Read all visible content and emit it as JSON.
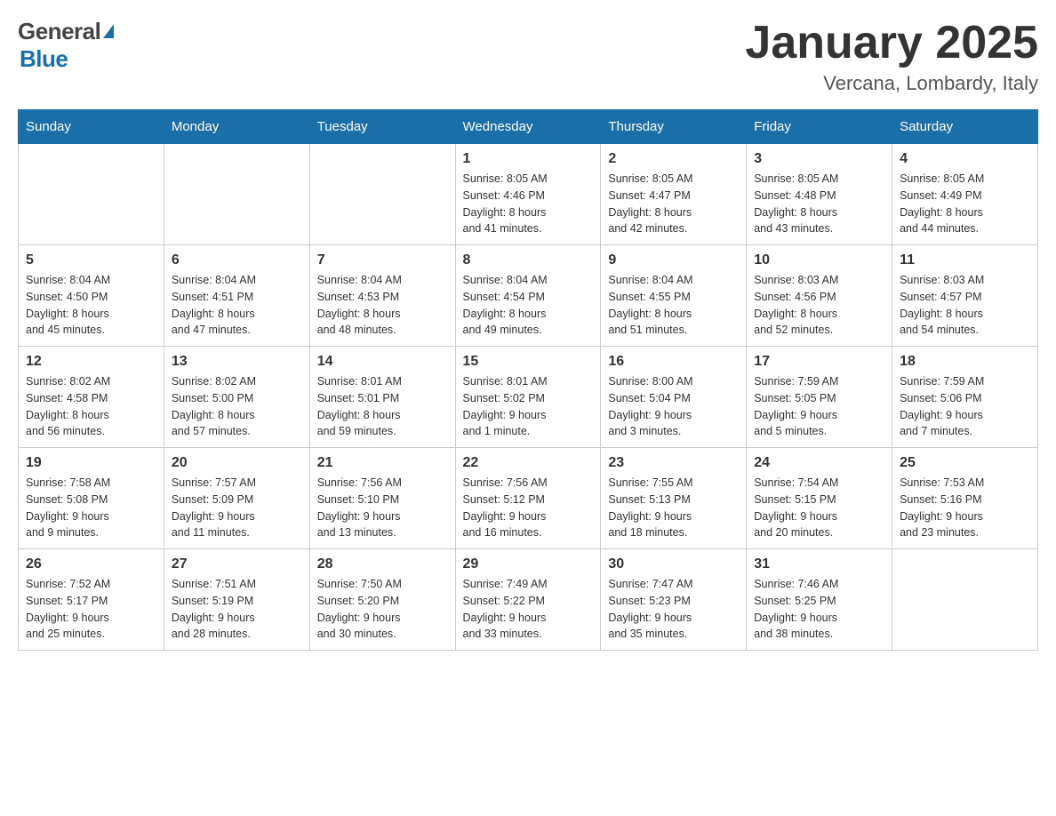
{
  "header": {
    "title": "January 2025",
    "subtitle": "Vercana, Lombardy, Italy"
  },
  "logo": {
    "part1": "General",
    "part2": "Blue"
  },
  "columns": [
    "Sunday",
    "Monday",
    "Tuesday",
    "Wednesday",
    "Thursday",
    "Friday",
    "Saturday"
  ],
  "weeks": [
    [
      {
        "day": "",
        "info": ""
      },
      {
        "day": "",
        "info": ""
      },
      {
        "day": "",
        "info": ""
      },
      {
        "day": "1",
        "info": "Sunrise: 8:05 AM\nSunset: 4:46 PM\nDaylight: 8 hours\nand 41 minutes."
      },
      {
        "day": "2",
        "info": "Sunrise: 8:05 AM\nSunset: 4:47 PM\nDaylight: 8 hours\nand 42 minutes."
      },
      {
        "day": "3",
        "info": "Sunrise: 8:05 AM\nSunset: 4:48 PM\nDaylight: 8 hours\nand 43 minutes."
      },
      {
        "day": "4",
        "info": "Sunrise: 8:05 AM\nSunset: 4:49 PM\nDaylight: 8 hours\nand 44 minutes."
      }
    ],
    [
      {
        "day": "5",
        "info": "Sunrise: 8:04 AM\nSunset: 4:50 PM\nDaylight: 8 hours\nand 45 minutes."
      },
      {
        "day": "6",
        "info": "Sunrise: 8:04 AM\nSunset: 4:51 PM\nDaylight: 8 hours\nand 47 minutes."
      },
      {
        "day": "7",
        "info": "Sunrise: 8:04 AM\nSunset: 4:53 PM\nDaylight: 8 hours\nand 48 minutes."
      },
      {
        "day": "8",
        "info": "Sunrise: 8:04 AM\nSunset: 4:54 PM\nDaylight: 8 hours\nand 49 minutes."
      },
      {
        "day": "9",
        "info": "Sunrise: 8:04 AM\nSunset: 4:55 PM\nDaylight: 8 hours\nand 51 minutes."
      },
      {
        "day": "10",
        "info": "Sunrise: 8:03 AM\nSunset: 4:56 PM\nDaylight: 8 hours\nand 52 minutes."
      },
      {
        "day": "11",
        "info": "Sunrise: 8:03 AM\nSunset: 4:57 PM\nDaylight: 8 hours\nand 54 minutes."
      }
    ],
    [
      {
        "day": "12",
        "info": "Sunrise: 8:02 AM\nSunset: 4:58 PM\nDaylight: 8 hours\nand 56 minutes."
      },
      {
        "day": "13",
        "info": "Sunrise: 8:02 AM\nSunset: 5:00 PM\nDaylight: 8 hours\nand 57 minutes."
      },
      {
        "day": "14",
        "info": "Sunrise: 8:01 AM\nSunset: 5:01 PM\nDaylight: 8 hours\nand 59 minutes."
      },
      {
        "day": "15",
        "info": "Sunrise: 8:01 AM\nSunset: 5:02 PM\nDaylight: 9 hours\nand 1 minute."
      },
      {
        "day": "16",
        "info": "Sunrise: 8:00 AM\nSunset: 5:04 PM\nDaylight: 9 hours\nand 3 minutes."
      },
      {
        "day": "17",
        "info": "Sunrise: 7:59 AM\nSunset: 5:05 PM\nDaylight: 9 hours\nand 5 minutes."
      },
      {
        "day": "18",
        "info": "Sunrise: 7:59 AM\nSunset: 5:06 PM\nDaylight: 9 hours\nand 7 minutes."
      }
    ],
    [
      {
        "day": "19",
        "info": "Sunrise: 7:58 AM\nSunset: 5:08 PM\nDaylight: 9 hours\nand 9 minutes."
      },
      {
        "day": "20",
        "info": "Sunrise: 7:57 AM\nSunset: 5:09 PM\nDaylight: 9 hours\nand 11 minutes."
      },
      {
        "day": "21",
        "info": "Sunrise: 7:56 AM\nSunset: 5:10 PM\nDaylight: 9 hours\nand 13 minutes."
      },
      {
        "day": "22",
        "info": "Sunrise: 7:56 AM\nSunset: 5:12 PM\nDaylight: 9 hours\nand 16 minutes."
      },
      {
        "day": "23",
        "info": "Sunrise: 7:55 AM\nSunset: 5:13 PM\nDaylight: 9 hours\nand 18 minutes."
      },
      {
        "day": "24",
        "info": "Sunrise: 7:54 AM\nSunset: 5:15 PM\nDaylight: 9 hours\nand 20 minutes."
      },
      {
        "day": "25",
        "info": "Sunrise: 7:53 AM\nSunset: 5:16 PM\nDaylight: 9 hours\nand 23 minutes."
      }
    ],
    [
      {
        "day": "26",
        "info": "Sunrise: 7:52 AM\nSunset: 5:17 PM\nDaylight: 9 hours\nand 25 minutes."
      },
      {
        "day": "27",
        "info": "Sunrise: 7:51 AM\nSunset: 5:19 PM\nDaylight: 9 hours\nand 28 minutes."
      },
      {
        "day": "28",
        "info": "Sunrise: 7:50 AM\nSunset: 5:20 PM\nDaylight: 9 hours\nand 30 minutes."
      },
      {
        "day": "29",
        "info": "Sunrise: 7:49 AM\nSunset: 5:22 PM\nDaylight: 9 hours\nand 33 minutes."
      },
      {
        "day": "30",
        "info": "Sunrise: 7:47 AM\nSunset: 5:23 PM\nDaylight: 9 hours\nand 35 minutes."
      },
      {
        "day": "31",
        "info": "Sunrise: 7:46 AM\nSunset: 5:25 PM\nDaylight: 9 hours\nand 38 minutes."
      },
      {
        "day": "",
        "info": ""
      }
    ]
  ]
}
